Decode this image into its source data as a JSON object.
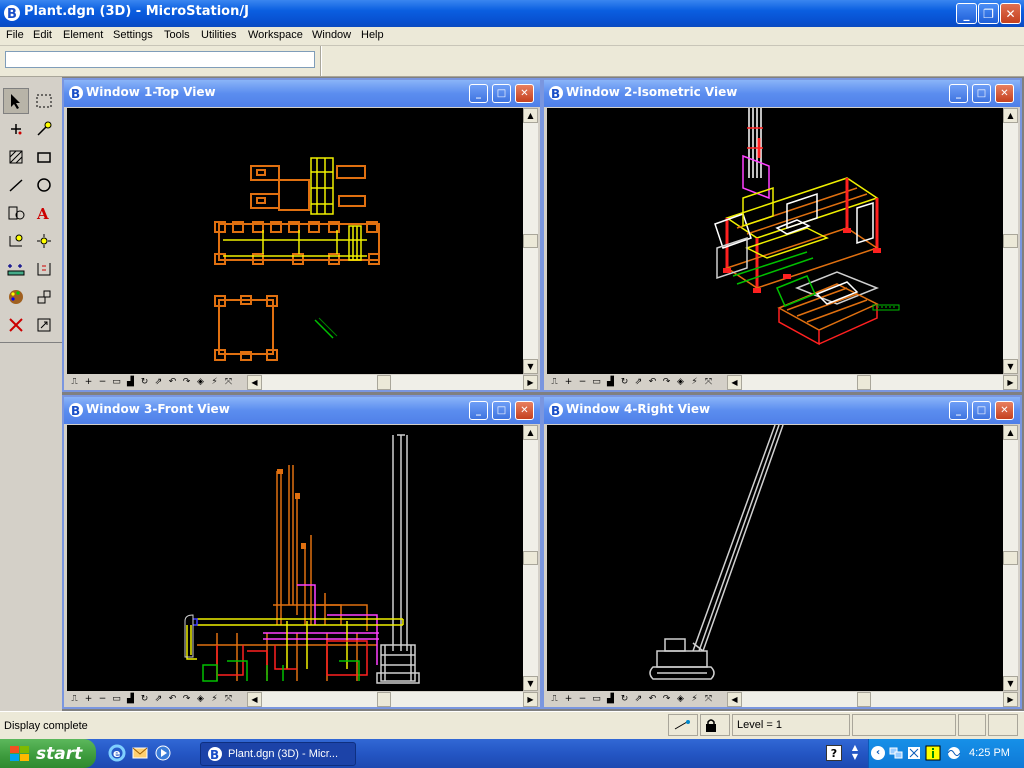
{
  "app": {
    "title": "Plant.dgn (3D) - MicroStation/J"
  },
  "menu": [
    "File",
    "Edit",
    "Element",
    "Settings",
    "Tools",
    "Utilities",
    "Workspace",
    "Window",
    "Help"
  ],
  "keyin": {
    "value": ""
  },
  "palette_tools": [
    "element-selection-icon",
    "fence-icon",
    "point-icon",
    "measure-icon",
    "patterning-icon",
    "polygon-icon",
    "line-icon",
    "circle-icon",
    "cell-icon",
    "text-icon",
    "dimension-icon",
    "modify-icon",
    "copy-icon",
    "drop-icon",
    "palette-icon",
    "change-attributes-icon",
    "delete-icon",
    "view-control-icon"
  ],
  "views": [
    {
      "title": "Window 1-Top View"
    },
    {
      "title": "Window 2-Isometric View"
    },
    {
      "title": "Window 3-Front View"
    },
    {
      "title": "Window 4-Right View"
    }
  ],
  "status": {
    "message": "Display complete",
    "level": "Level = 1"
  },
  "taskbar": {
    "start_label": "start",
    "task_label": "Plant.dgn (3D) - Micr...",
    "clock": "4:25 PM"
  },
  "colors": {
    "orange": "#e07010",
    "yellow": "#f0f000",
    "white": "#ffffff",
    "green": "#00c000",
    "red": "#ff2020",
    "magenta": "#ff40ff",
    "blue": "#4040ff",
    "gray": "#d0d0d0"
  }
}
